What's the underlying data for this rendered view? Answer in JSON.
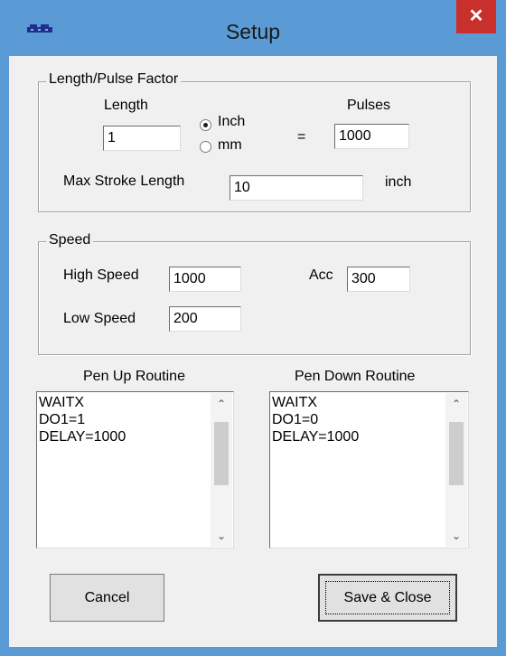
{
  "window": {
    "title": "Setup",
    "close_label": "✕",
    "accent": "#5b9bd5"
  },
  "length_group": {
    "label": "Length/Pulse Factor",
    "length_label": "Length",
    "length_value": "1",
    "unit_options": [
      {
        "label": "Inch",
        "selected": true
      },
      {
        "label": "mm",
        "selected": false
      }
    ],
    "equals": "=",
    "pulses_label": "Pulses",
    "pulses_value": "1000",
    "max_stroke_label": "Max Stroke Length",
    "max_stroke_value": "10",
    "max_stroke_unit": "inch"
  },
  "speed_group": {
    "label": "Speed",
    "high_speed_label": "High Speed",
    "high_speed_value": "1000",
    "acc_label": "Acc",
    "acc_value": "300",
    "low_speed_label": "Low Speed",
    "low_speed_value": "200"
  },
  "pen_up": {
    "label": "Pen Up Routine",
    "text": "WAITX\nDO1=1\nDELAY=1000"
  },
  "pen_down": {
    "label": "Pen Down Routine",
    "text": "WAITX\nDO1=0\nDELAY=1000"
  },
  "buttons": {
    "cancel": "Cancel",
    "save_close": "Save & Close"
  }
}
